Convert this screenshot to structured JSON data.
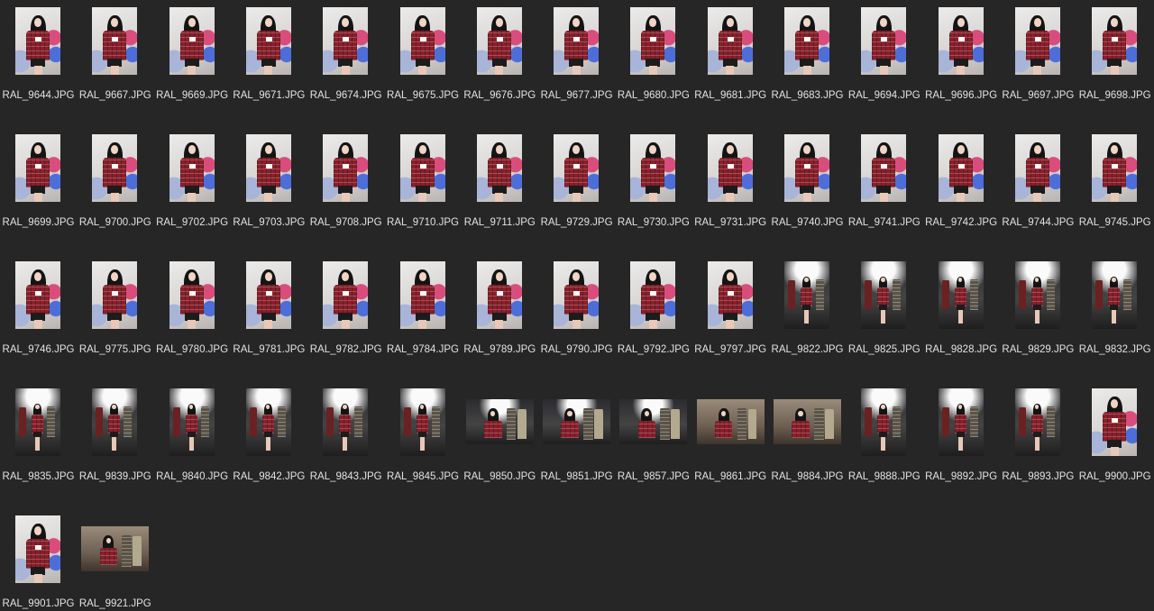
{
  "files": [
    {
      "name": "RAL_9644.JPG",
      "orientation": "portrait",
      "scene": "backdrop"
    },
    {
      "name": "RAL_9667.JPG",
      "orientation": "portrait",
      "scene": "backdrop"
    },
    {
      "name": "RAL_9669.JPG",
      "orientation": "portrait",
      "scene": "backdrop"
    },
    {
      "name": "RAL_9671.JPG",
      "orientation": "portrait",
      "scene": "backdrop"
    },
    {
      "name": "RAL_9674.JPG",
      "orientation": "portrait",
      "scene": "backdrop"
    },
    {
      "name": "RAL_9675.JPG",
      "orientation": "portrait",
      "scene": "backdrop"
    },
    {
      "name": "RAL_9676.JPG",
      "orientation": "portrait",
      "scene": "backdrop"
    },
    {
      "name": "RAL_9677.JPG",
      "orientation": "portrait",
      "scene": "backdrop"
    },
    {
      "name": "RAL_9680.JPG",
      "orientation": "portrait",
      "scene": "backdrop"
    },
    {
      "name": "RAL_9681.JPG",
      "orientation": "portrait",
      "scene": "backdrop"
    },
    {
      "name": "RAL_9683.JPG",
      "orientation": "portrait",
      "scene": "backdrop"
    },
    {
      "name": "RAL_9694.JPG",
      "orientation": "portrait",
      "scene": "backdrop"
    },
    {
      "name": "RAL_9696.JPG",
      "orientation": "portrait",
      "scene": "backdrop"
    },
    {
      "name": "RAL_9697.JPG",
      "orientation": "portrait",
      "scene": "backdrop"
    },
    {
      "name": "RAL_9698.JPG",
      "orientation": "portrait",
      "scene": "backdrop"
    },
    {
      "name": "RAL_9699.JPG",
      "orientation": "portrait",
      "scene": "backdrop"
    },
    {
      "name": "RAL_9700.JPG",
      "orientation": "portrait",
      "scene": "backdrop"
    },
    {
      "name": "RAL_9702.JPG",
      "orientation": "portrait",
      "scene": "backdrop"
    },
    {
      "name": "RAL_9703.JPG",
      "orientation": "portrait",
      "scene": "backdrop"
    },
    {
      "name": "RAL_9708.JPG",
      "orientation": "portrait",
      "scene": "backdrop"
    },
    {
      "name": "RAL_9710.JPG",
      "orientation": "portrait",
      "scene": "backdrop"
    },
    {
      "name": "RAL_9711.JPG",
      "orientation": "portrait",
      "scene": "backdrop"
    },
    {
      "name": "RAL_9729.JPG",
      "orientation": "portrait",
      "scene": "backdrop"
    },
    {
      "name": "RAL_9730.JPG",
      "orientation": "portrait",
      "scene": "backdrop"
    },
    {
      "name": "RAL_9731.JPG",
      "orientation": "portrait",
      "scene": "backdrop"
    },
    {
      "name": "RAL_9740.JPG",
      "orientation": "portrait",
      "scene": "backdrop"
    },
    {
      "name": "RAL_9741.JPG",
      "orientation": "portrait",
      "scene": "backdrop"
    },
    {
      "name": "RAL_9742.JPG",
      "orientation": "portrait",
      "scene": "backdrop"
    },
    {
      "name": "RAL_9744.JPG",
      "orientation": "portrait",
      "scene": "backdrop"
    },
    {
      "name": "RAL_9745.JPG",
      "orientation": "portrait",
      "scene": "backdrop"
    },
    {
      "name": "RAL_9746.JPG",
      "orientation": "portrait",
      "scene": "backdrop"
    },
    {
      "name": "RAL_9775.JPG",
      "orientation": "portrait",
      "scene": "backdrop"
    },
    {
      "name": "RAL_9780.JPG",
      "orientation": "portrait",
      "scene": "backdrop"
    },
    {
      "name": "RAL_9781.JPG",
      "orientation": "portrait",
      "scene": "backdrop"
    },
    {
      "name": "RAL_9782.JPG",
      "orientation": "portrait",
      "scene": "backdrop"
    },
    {
      "name": "RAL_9784.JPG",
      "orientation": "portrait",
      "scene": "backdrop"
    },
    {
      "name": "RAL_9789.JPG",
      "orientation": "portrait",
      "scene": "backdrop"
    },
    {
      "name": "RAL_9790.JPG",
      "orientation": "portrait",
      "scene": "backdrop"
    },
    {
      "name": "RAL_9792.JPG",
      "orientation": "portrait",
      "scene": "backdrop"
    },
    {
      "name": "RAL_9797.JPG",
      "orientation": "portrait",
      "scene": "backdrop"
    },
    {
      "name": "RAL_9822.JPG",
      "orientation": "portrait",
      "scene": "stage"
    },
    {
      "name": "RAL_9825.JPG",
      "orientation": "portrait",
      "scene": "stage"
    },
    {
      "name": "RAL_9828.JPG",
      "orientation": "portrait",
      "scene": "stage"
    },
    {
      "name": "RAL_9829.JPG",
      "orientation": "portrait",
      "scene": "stage"
    },
    {
      "name": "RAL_9832.JPG",
      "orientation": "portrait",
      "scene": "stage"
    },
    {
      "name": "RAL_9835.JPG",
      "orientation": "portrait",
      "scene": "stage"
    },
    {
      "name": "RAL_9839.JPG",
      "orientation": "portrait",
      "scene": "stage"
    },
    {
      "name": "RAL_9840.JPG",
      "orientation": "portrait",
      "scene": "stage"
    },
    {
      "name": "RAL_9842.JPG",
      "orientation": "portrait",
      "scene": "stage"
    },
    {
      "name": "RAL_9843.JPG",
      "orientation": "portrait",
      "scene": "stage"
    },
    {
      "name": "RAL_9845.JPG",
      "orientation": "portrait",
      "scene": "stage"
    },
    {
      "name": "RAL_9850.JPG",
      "orientation": "landscape",
      "scene": "stage"
    },
    {
      "name": "RAL_9851.JPG",
      "orientation": "landscape",
      "scene": "stage"
    },
    {
      "name": "RAL_9857.JPG",
      "orientation": "landscape",
      "scene": "stage"
    },
    {
      "name": "RAL_9861.JPG",
      "orientation": "landscape",
      "scene": "warm"
    },
    {
      "name": "RAL_9884.JPG",
      "orientation": "landscape",
      "scene": "warm"
    },
    {
      "name": "RAL_9888.JPG",
      "orientation": "portrait",
      "scene": "stage"
    },
    {
      "name": "RAL_9892.JPG",
      "orientation": "portrait",
      "scene": "stage"
    },
    {
      "name": "RAL_9893.JPG",
      "orientation": "portrait",
      "scene": "stage"
    },
    {
      "name": "RAL_9900.JPG",
      "orientation": "portrait",
      "scene": "backdrop"
    },
    {
      "name": "RAL_9901.JPG",
      "orientation": "portrait",
      "scene": "backdrop"
    },
    {
      "name": "RAL_9921.JPG",
      "orientation": "landscape",
      "scene": "warm"
    }
  ],
  "colors": {
    "background": "#262626",
    "filename_text": "#e2e2e2",
    "jacket": "#8a1f2a"
  }
}
